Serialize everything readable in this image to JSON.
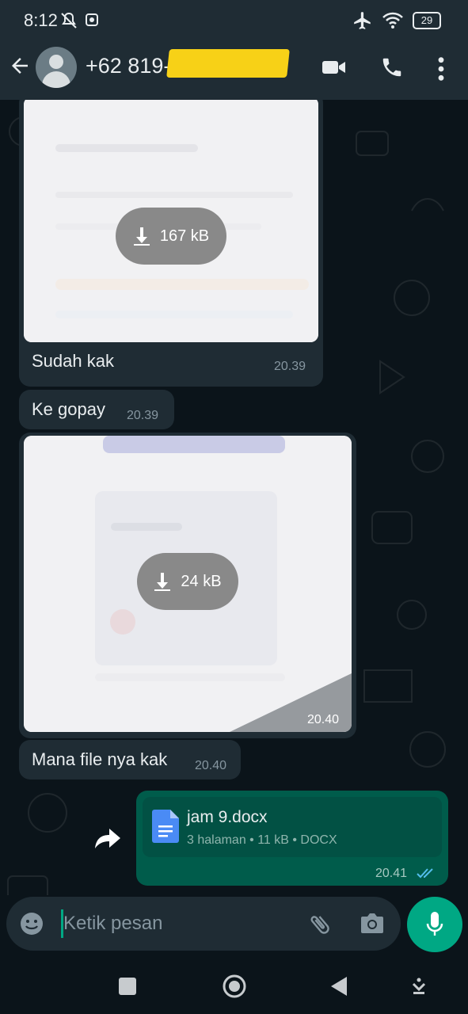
{
  "status_bar": {
    "time": "8:12",
    "battery": "29"
  },
  "header": {
    "contact": "+62 819-"
  },
  "messages": [
    {
      "type": "image",
      "download_size": "167 kB",
      "caption": "Sudah kak",
      "time": "20.39"
    },
    {
      "type": "text",
      "text": "Ke gopay",
      "time": "20.39"
    },
    {
      "type": "image",
      "download_size": "24 kB",
      "time": "20.40"
    },
    {
      "type": "text",
      "text": "Mana file nya kak",
      "time": "20.40"
    },
    {
      "type": "document",
      "file_name": "jam 9.docx",
      "meta": "3 halaman • 11 kB • DOCX",
      "time": "20.41",
      "status": "read"
    }
  ],
  "composer": {
    "placeholder": "Ketik pesan"
  },
  "colors": {
    "accent": "#00a884",
    "outgoing_bubble": "#005c4b",
    "incoming_bubble": "#1f2c34",
    "read_ticks": "#53bdeb",
    "redaction": "#f7d117"
  }
}
